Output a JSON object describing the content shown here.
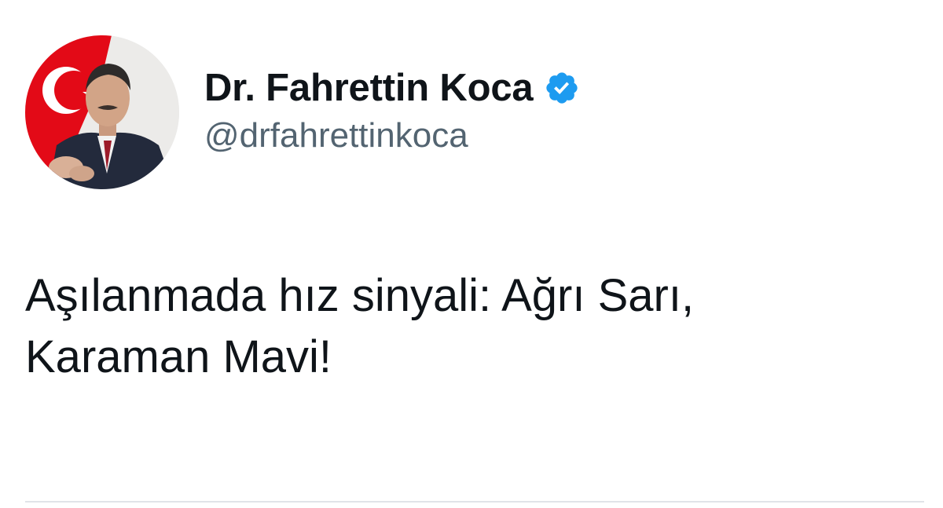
{
  "author": {
    "display_name": "Dr. Fahrettin Koca",
    "handle": "@drfahrettinkoca",
    "verified": true
  },
  "tweet": {
    "text_line1": "Aşılanmada hız sinyali: Ağrı Sarı,",
    "text_line2": "Karaman Mavi!"
  },
  "icons": {
    "verified": "verified-badge-icon",
    "avatar": "profile-photo"
  },
  "colors": {
    "text_primary": "#0f1419",
    "text_secondary": "#536471",
    "verified_blue": "#1d9bf0",
    "flag_red": "#e30a17"
  }
}
